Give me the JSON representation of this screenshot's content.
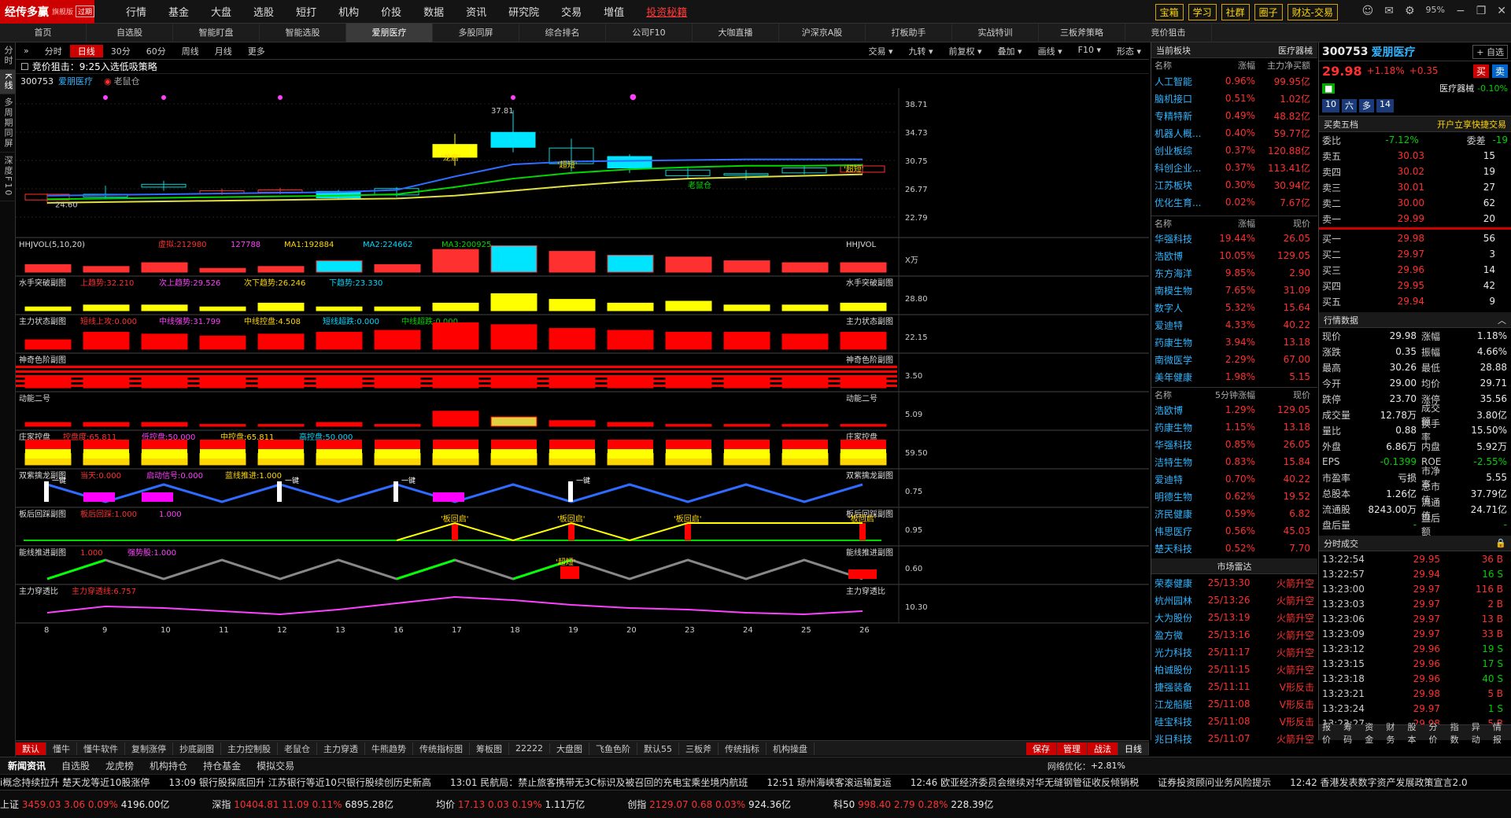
{
  "app": {
    "name": "经传多赢",
    "edition": "旗舰版",
    "expired": "过期"
  },
  "topmenu": [
    "行情",
    "基金",
    "大盘",
    "选股",
    "短打",
    "机构",
    "价投",
    "数据",
    "资讯",
    "研究院",
    "交易",
    "增值"
  ],
  "topmenu_highlight": "投资秘籍",
  "top_buttons": [
    "宝箱",
    "学习",
    "社群",
    "圈子",
    "财达-交易"
  ],
  "zoom": "95%",
  "tabs": [
    "首页",
    "自选股",
    "智能盯盘",
    "智能选股",
    "爱朋医疗",
    "多股同屏",
    "综合排名",
    "公司F10",
    "大咖直播",
    "沪深京A股",
    "打板助手",
    "实战特训",
    "三板斧策略",
    "竞价狙击"
  ],
  "active_tab": "爱朋医疗",
  "leftbar": [
    "分时",
    "K线",
    "多周期同屏",
    "深度F10"
  ],
  "periods": [
    "分时",
    "日线",
    "30分",
    "60分",
    "周线",
    "月线",
    "更多"
  ],
  "period_active": "日线",
  "toolbar_right": [
    "交易",
    "九转",
    "前复权",
    "叠加",
    "画线",
    "F10",
    "形态"
  ],
  "strategy_title": "竞价狙击：9:25入选低吸策略",
  "stock": {
    "code": "300753",
    "name": "爱朋医疗",
    "tag": "老鼠仓",
    "price": "29.98",
    "change_pct": "+1.18%",
    "change": "+0.35",
    "sector": "医疗器械",
    "sector_pct": "-0.10%"
  },
  "main_chart": {
    "y_labels": [
      "38.71",
      "34.73",
      "30.75",
      "26.77",
      "22.79"
    ],
    "label_high": "37.81",
    "label_low": "24.60",
    "annotations": [
      "'龙启'",
      "'超短'",
      "'超短'",
      "老鼠仓"
    ]
  },
  "x_labels": [
    "8",
    "9",
    "10",
    "11",
    "12",
    "13",
    "16",
    "17",
    "18",
    "19",
    "20",
    "23",
    "24",
    "25",
    "26"
  ],
  "indicators": [
    {
      "name": "HHJVOL(5,10,20)",
      "items": [
        "虚拟:212980",
        "127788",
        "MA1:192884",
        "MA2:224662",
        "MA3:200925"
      ],
      "right": "HHJVOL",
      "scale": "X万"
    },
    {
      "name": "水手突破副图",
      "items": [
        "上趋势:32.210",
        "次上趋势:29.526",
        "次下趋势:26.246",
        "下趋势:23.330"
      ],
      "right": "水手突破副图",
      "scale": "28.80"
    },
    {
      "name": "主力状态副图",
      "items": [
        "短线上攻:0.000",
        "中线强势:31.799",
        "中线控盘:4.508",
        "短线超跌:0.000",
        "中线超跌:0.000"
      ],
      "right": "主力状态副图",
      "scale": "22.15"
    },
    {
      "name": "神奇色阶副图",
      "items": [],
      "right": "神奇色阶副图",
      "scale": "3.50"
    },
    {
      "name": "动能二号",
      "items": [],
      "right": "动能二号",
      "scale": "5.09"
    },
    {
      "name": "庄家控盘",
      "items": [
        "控盘度:65.811",
        "低控盘:50.000",
        "中控盘:65.811",
        "高控盘:50.000"
      ],
      "right": "庄家控盘",
      "scale": "59.50"
    },
    {
      "name": "双紫擒龙副图",
      "items": [
        "当天:0.000",
        "启动信号:0.000",
        "蓝线推进:1.000"
      ],
      "right": "双紫擒龙副图",
      "scale": "0.75"
    },
    {
      "name": "板后回踩副图",
      "items": [
        "板后回踩:1.000",
        "1.000"
      ],
      "right": "板后回踩副图",
      "scale": "0.95"
    },
    {
      "name": "能线推进副图",
      "items": [
        "1.000",
        "强势股:1.000"
      ],
      "right": "能线推进副图",
      "scale": "0.60"
    },
    {
      "name": "主力穿透比",
      "items": [
        "主力穿透线:6.757"
      ],
      "right": "主力穿透比",
      "scale": "10.30"
    }
  ],
  "indicator_annotations": {
    "yijian": "一键",
    "banhui": "'板回启'",
    "chaoduan": "'超短'"
  },
  "bottom_tabs": [
    "默认",
    "懂牛",
    "懂牛软件",
    "复制涨停",
    "抄底副图",
    "主力控制股",
    "老鼠仓",
    "主力穿透",
    "牛熊趋势",
    "传统指标图",
    "筹板图",
    "22222",
    "大盘图",
    "飞鱼色阶",
    "默认55",
    "三板斧",
    "传统指标",
    "机构操盘"
  ],
  "bottom_right": [
    "保存",
    "管理",
    "战法",
    "日线"
  ],
  "sector_panel": {
    "title": "当前板块",
    "subtitle": "医疗器械",
    "headers": [
      "名称",
      "涨幅",
      "主力净买额"
    ],
    "rows": [
      [
        "人工智能",
        "0.96%",
        "99.95亿"
      ],
      [
        "脑机接口",
        "0.51%",
        "1.02亿"
      ],
      [
        "专精特新",
        "0.49%",
        "48.82亿"
      ],
      [
        "机器人概...",
        "0.40%",
        "59.77亿"
      ],
      [
        "创业板综",
        "0.37%",
        "120.88亿"
      ],
      [
        "科创企业...",
        "0.37%",
        "113.41亿"
      ],
      [
        "江苏板块",
        "0.30%",
        "30.94亿"
      ],
      [
        "优化生育...",
        "0.02%",
        "7.67亿"
      ]
    ]
  },
  "gainers": {
    "headers": [
      "名称",
      "涨幅",
      "现价"
    ],
    "rows": [
      [
        "华强科技",
        "19.44%",
        "26.05"
      ],
      [
        "浩欧博",
        "10.05%",
        "129.05"
      ],
      [
        "东方海洋",
        "9.85%",
        "2.90"
      ],
      [
        "南模生物",
        "7.65%",
        "31.09"
      ],
      [
        "数字人",
        "5.32%",
        "15.64"
      ],
      [
        "爱迪特",
        "4.33%",
        "40.22"
      ],
      [
        "药康生物",
        "3.94%",
        "13.18"
      ],
      [
        "南微医学",
        "2.29%",
        "67.00"
      ],
      [
        "美年健康",
        "1.98%",
        "5.15"
      ]
    ]
  },
  "five_min": {
    "headers": [
      "名称",
      "5分钟涨幅",
      "现价"
    ],
    "rows": [
      [
        "浩欧博",
        "1.29%",
        "129.05"
      ],
      [
        "药康生物",
        "1.15%",
        "13.18"
      ],
      [
        "华强科技",
        "0.85%",
        "26.05"
      ],
      [
        "洁特生物",
        "0.83%",
        "15.84"
      ],
      [
        "爱迪特",
        "0.70%",
        "40.22"
      ],
      [
        "明德生物",
        "0.62%",
        "19.52"
      ],
      [
        "济民健康",
        "0.59%",
        "6.82"
      ],
      [
        "伟思医疗",
        "0.56%",
        "45.03"
      ],
      [
        "楚天科技",
        "0.52%",
        "7.70"
      ]
    ]
  },
  "radar": {
    "title": "市场雷达",
    "rows": [
      [
        "荣泰健康",
        "25/13:30",
        "火箭升空"
      ],
      [
        "杭州园林",
        "25/13:26",
        "火箭升空"
      ],
      [
        "大为股份",
        "25/13:19",
        "火箭升空"
      ],
      [
        "盈方微",
        "25/13:16",
        "火箭升空"
      ],
      [
        "光力科技",
        "25/11:17",
        "火箭升空"
      ],
      [
        "柏诚股份",
        "25/11:15",
        "火箭升空"
      ],
      [
        "捷强装备",
        "25/11:11",
        "V形反击"
      ],
      [
        "江龙船艇",
        "25/11:08",
        "V形反击"
      ],
      [
        "硅宝科技",
        "25/11:08",
        "V形反击"
      ],
      [
        "兆日科技",
        "25/11:07",
        "火箭升空"
      ]
    ]
  },
  "quote": {
    "watch": "+ 自选",
    "buy": "买",
    "sell": "卖",
    "badges": [
      "10",
      "六",
      "多",
      "14"
    ],
    "five_title": "买卖五档",
    "open_trade": "开户立享快捷交易",
    "webi_label": "委比",
    "webi": "-7.12%",
    "weicha_label": "委差",
    "weicha": "-19",
    "sells": [
      [
        "卖五",
        "30.03",
        "15"
      ],
      [
        "卖四",
        "30.02",
        "19"
      ],
      [
        "卖三",
        "30.01",
        "27"
      ],
      [
        "卖二",
        "30.00",
        "62"
      ],
      [
        "卖一",
        "29.99",
        "20"
      ]
    ],
    "buys": [
      [
        "买一",
        "29.98",
        "56"
      ],
      [
        "买二",
        "29.97",
        "3"
      ],
      [
        "买三",
        "29.96",
        "14"
      ],
      [
        "买四",
        "29.95",
        "42"
      ],
      [
        "买五",
        "29.94",
        "9"
      ]
    ],
    "data_title": "行情数据",
    "kv": [
      [
        "现价",
        "29.98",
        "涨幅",
        "1.18%"
      ],
      [
        "涨跌",
        "0.35",
        "振幅",
        "4.66%"
      ],
      [
        "最高",
        "30.26",
        "最低",
        "28.88"
      ],
      [
        "今开",
        "29.00",
        "均价",
        "29.71"
      ],
      [
        "跌停",
        "23.70",
        "涨停",
        "35.56"
      ],
      [
        "成交量",
        "12.78万",
        "成交额",
        "3.80亿"
      ],
      [
        "量比",
        "0.88",
        "换手率",
        "15.50%"
      ],
      [
        "外盘",
        "6.86万",
        "内盘",
        "5.92万"
      ],
      [
        "EPS",
        "-0.1399",
        "ROE",
        "-2.55%"
      ],
      [
        "市盈率",
        "亏损",
        "市净率",
        "5.55"
      ],
      [
        "总股本",
        "1.26亿",
        "总市值",
        "37.79亿"
      ],
      [
        "流通股",
        "8243.00万",
        "流通值",
        "24.71亿"
      ],
      [
        "盘后量",
        "-",
        "盘后额",
        "-"
      ]
    ],
    "ticks_title": "分时成交",
    "ticks": [
      [
        "13:22:54",
        "29.95",
        "36 B"
      ],
      [
        "13:22:57",
        "29.94",
        "16 S"
      ],
      [
        "13:23:00",
        "29.97",
        "116 B"
      ],
      [
        "13:23:03",
        "29.97",
        "2 B"
      ],
      [
        "13:23:06",
        "29.97",
        "13 B"
      ],
      [
        "13:23:09",
        "29.97",
        "33 B"
      ],
      [
        "13:23:12",
        "29.96",
        "19 S"
      ],
      [
        "13:23:15",
        "29.96",
        "17 S"
      ],
      [
        "13:23:18",
        "29.96",
        "40 S"
      ],
      [
        "13:23:21",
        "29.98",
        "5 B"
      ],
      [
        "13:23:24",
        "29.97",
        "1 S"
      ],
      [
        "13:23:27",
        "29.98",
        "5 B"
      ]
    ],
    "bottom_tabs": [
      "报价",
      "筹码",
      "资金",
      "财务",
      "股本",
      "分价",
      "指数",
      "异动",
      "情报"
    ]
  },
  "news_tabs": [
    "新闻资讯",
    "自选股",
    "龙虎榜",
    "机构持仓",
    "持仓基金",
    "模拟交易"
  ],
  "network": "网络优化：",
  "network_val": "+2.81%",
  "ticker": [
    "i概念持续拉升 楚天龙等近10股涨停",
    "13:09 银行股探底回升 江苏银行等近10只银行股续创历史新高",
    "13:01 民航局：禁止旅客携带无3C标识及被召回的充电宝乘坐境内航班",
    "12:51 琼州海峡客滚运输复运",
    "12:46 欧亚经济委员会继续对华无缝钢管征收反倾销税",
    "证券投资顾问业务风险提示",
    "12:42 香港发表数字资产发展政策宣言2.0"
  ],
  "indexes": [
    {
      "n": "上证",
      "v": "3459.03",
      "c": "3.06",
      "p": "0.09%",
      "a": "4196.00亿"
    },
    {
      "n": "深指",
      "v": "10404.81",
      "c": "11.09",
      "p": "0.11%",
      "a": "6895.28亿"
    },
    {
      "n": "均价",
      "v": "17.13",
      "c": "0.03",
      "p": "0.19%",
      "a": "1.11万亿"
    },
    {
      "n": "创指",
      "v": "2129.07",
      "c": "0.68",
      "p": "0.03%",
      "a": "924.36亿"
    },
    {
      "n": "科50",
      "v": "998.40",
      "c": "2.79",
      "p": "0.28%",
      "a": "228.39亿"
    }
  ],
  "colors": {
    "up": "#ff3030",
    "down": "#00d000",
    "accent": "#cc0000",
    "cyan": "#00ffff",
    "yellow": "#ffff00"
  }
}
